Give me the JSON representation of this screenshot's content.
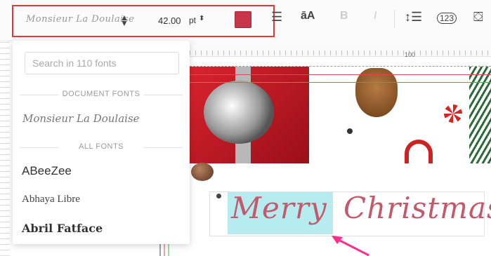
{
  "toolbar": {
    "font_preview": "Monsieur La Doulaise",
    "font_size": "42.00",
    "unit": "pt",
    "text_color": "#c8344a"
  },
  "ruler": {
    "label": "100"
  },
  "font_dropdown": {
    "search_placeholder": "Search in 110 fonts",
    "document_fonts_header": "DOCUMENT FONTS",
    "document_font": "Monsieur La Doulaise",
    "all_fonts_header": "ALL FONTS",
    "fonts": [
      "ABeeZee",
      "Abhaya Libre",
      "Abril Fatface"
    ]
  },
  "canvas_text": {
    "word1": "Merry",
    "word2": "Christmas"
  }
}
